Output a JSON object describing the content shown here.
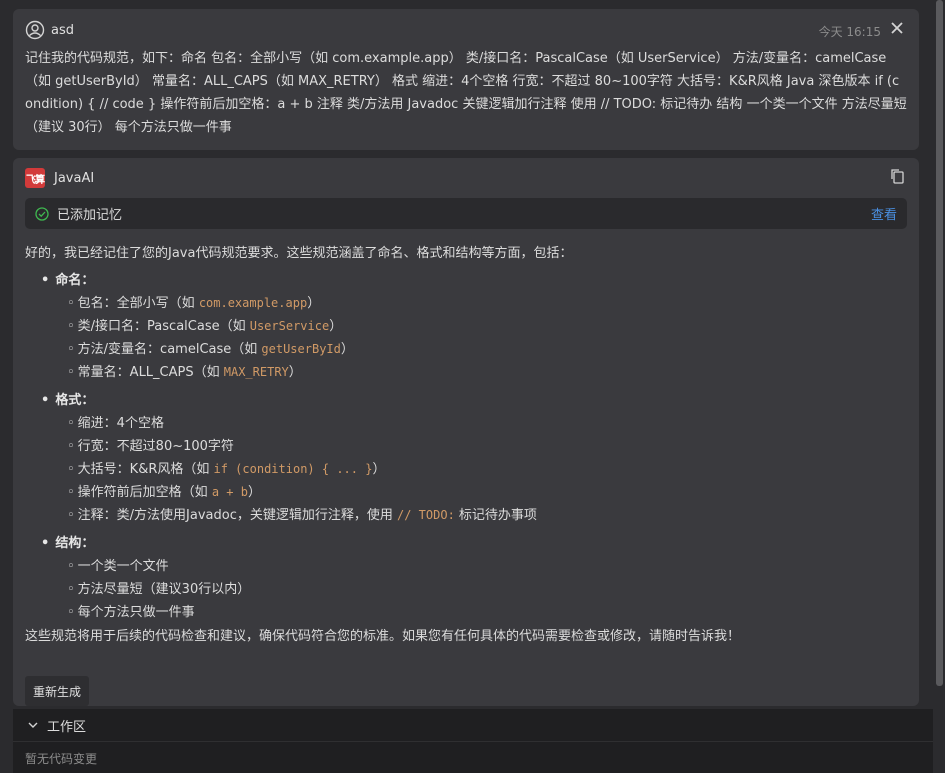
{
  "user_message": {
    "username": "asd",
    "timestamp": "今天 16:15",
    "text": "记住我的代码规范，如下：命名 包名：全部小写（如 com.example.app） 类/接口名：PascalCase（如 UserService） 方法/变量名：camelCase（如 getUserById） 常量名：ALL_CAPS（如 MAX_RETRY） 格式 缩进：4个空格 行宽：不超过 80~100字符 大括号：K&R风格 Java 深色版本 if (condition) { // code } 操作符前后加空格：a + b 注释 类/方法用 Javadoc 关键逻辑加行注释 使用 // TODO: 标记待办 结构 一个类一个文件 方法尽量短（建议 30行） 每个方法只做一件事"
  },
  "ai_message": {
    "logo_text": "飞算",
    "name": "JavaAI",
    "memory_status": "已添加记忆",
    "memory_link": "查看",
    "intro": "好的，我已经记住了您的Java代码规范要求。这些规范涵盖了命名、格式和结构等方面，包括：",
    "sections": [
      {
        "title": "命名：",
        "items": [
          {
            "pre": "包名：全部小写（如 ",
            "code": "com.example.app",
            "post": "）"
          },
          {
            "pre": "类/接口名：PascalCase（如 ",
            "code": "UserService",
            "post": "）"
          },
          {
            "pre": "方法/变量名：camelCase（如 ",
            "code": "getUserById",
            "post": "）"
          },
          {
            "pre": "常量名：ALL_CAPS（如 ",
            "code": "MAX_RETRY",
            "post": "）"
          }
        ]
      },
      {
        "title": "格式：",
        "items": [
          {
            "pre": "缩进：4个空格",
            "code": "",
            "post": ""
          },
          {
            "pre": "行宽：不超过80~100字符",
            "code": "",
            "post": ""
          },
          {
            "pre": "大括号：K&R风格（如 ",
            "code": "if (condition) { ... }",
            "post": "）"
          },
          {
            "pre": "操作符前后加空格（如 ",
            "code": "a + b",
            "post": "）"
          },
          {
            "pre": "注释：类/方法使用Javadoc，关键逻辑加行注释，使用 ",
            "code": "// TODO:",
            "post": " 标记待办事项"
          }
        ]
      },
      {
        "title": "结构：",
        "items": [
          {
            "pre": "一个类一个文件",
            "code": "",
            "post": ""
          },
          {
            "pre": "方法尽量短（建议30行以内）",
            "code": "",
            "post": ""
          },
          {
            "pre": "每个方法只做一件事",
            "code": "",
            "post": ""
          }
        ]
      }
    ],
    "outro": "这些规范将用于后续的代码检查和建议，确保代码符合您的标准。如果您有任何具体的代码需要检查或修改，请随时告诉我！",
    "regenerate_label": "重新生成"
  },
  "workspace": {
    "title": "工作区",
    "empty_text": "暂无代码变更"
  },
  "colors": {
    "accent_link": "#4a90e2",
    "code": "#d19a66",
    "success": "#3fb950",
    "logo_bg": "#d23a3a"
  }
}
